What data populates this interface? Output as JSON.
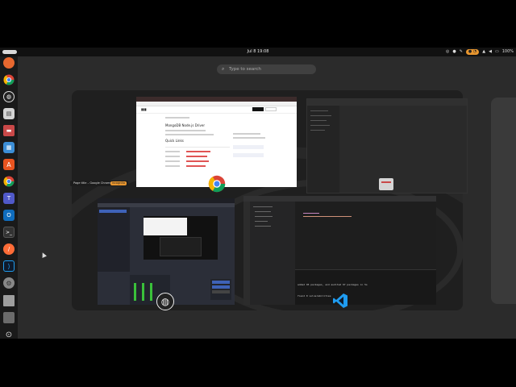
{
  "topbar": {
    "clock": "Jul 8 19:08",
    "battery": "100%"
  },
  "search": {
    "placeholder": "Type to search"
  },
  "dock": {
    "items": [
      {
        "name": "firefox",
        "color": "#e8682f"
      },
      {
        "name": "chrome",
        "color": "#db4437"
      },
      {
        "name": "obs-studio",
        "color": "#ffffff"
      },
      {
        "name": "files",
        "color": "#d4d4d4"
      },
      {
        "name": "thunderbird",
        "color": "#c94848"
      },
      {
        "name": "libreoffice",
        "color": "#3c8ed6"
      },
      {
        "name": "app-store",
        "color": "#e95420"
      },
      {
        "name": "chrome-alt",
        "color": "#db4437"
      },
      {
        "name": "teams",
        "color": "#5059c9"
      },
      {
        "name": "outlook",
        "color": "#0f6cbd"
      },
      {
        "name": "terminal",
        "color": "#333333"
      },
      {
        "name": "postman",
        "color": "#ff6c37"
      },
      {
        "name": "vscode",
        "color": "#1f9cf0"
      },
      {
        "name": "settings",
        "color": "#888888"
      },
      {
        "name": "text-editor",
        "color": "#9e9e9e"
      },
      {
        "name": "trash",
        "color": "#6b6b6b"
      },
      {
        "name": "show-apps",
        "color": "#e0e0e0"
      }
    ]
  },
  "windows": {
    "tooltip": {
      "label": "Page title – Google Chrome",
      "tag": "Incognito"
    },
    "chrome": {
      "heading": "MongoDB Node.js Driver",
      "section": "Quick Links"
    },
    "vscode": {
      "terminal_line1": "added 95 packages, and audited 97 packages in 5s",
      "terminal_line2": "found 0 vulnerabilities"
    }
  },
  "colors": {
    "accent": "#e8962f",
    "panel": "#111111",
    "workspace": "#1f1f1f"
  }
}
